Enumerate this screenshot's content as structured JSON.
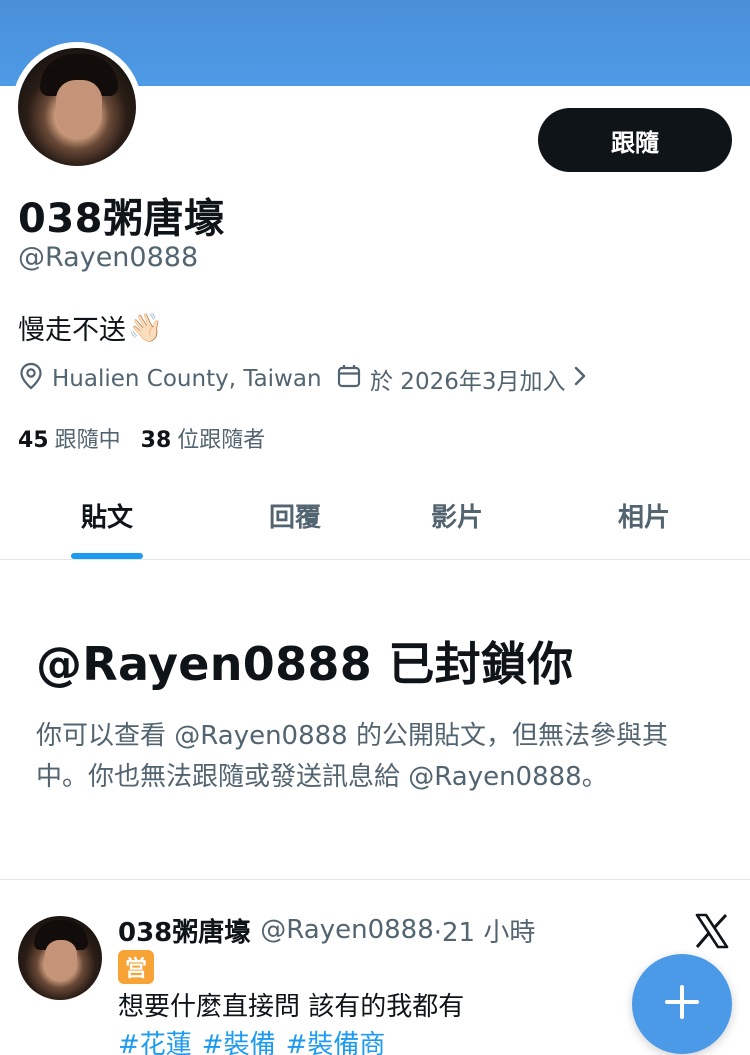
{
  "profile": {
    "display_name": "038粥唐壕",
    "handle": "@Rayen0888",
    "bio": "慢走不送",
    "bio_emoji": "👋🏻",
    "location": "Hualien County, Taiwan",
    "joined": "於 2026年3月加入",
    "following_count": "45",
    "following_label": "跟隨中",
    "followers_count": "38",
    "followers_label": "位跟隨者",
    "follow_button": "跟隨"
  },
  "tabs": [
    {
      "label": "貼文",
      "active": true
    },
    {
      "label": "回覆",
      "active": false
    },
    {
      "label": "影片",
      "active": false
    },
    {
      "label": "相片",
      "active": false
    }
  ],
  "blocked": {
    "title": "@Rayen0888 已封鎖你",
    "description": "你可以查看 @Rayen0888 的公開貼文，但無法參與其中。你也無法跟隨或發送訊息給 @Rayen0888。"
  },
  "post": {
    "name": "038粥唐壕",
    "handle": "@Rayen0888",
    "time": "·21 小時",
    "badge": "営",
    "text": "想要什麼直接問 該有的我都有",
    "tags": [
      "#花蓮",
      "#裝備",
      "#裝備商"
    ]
  },
  "colors": {
    "banner": "#4a92dc",
    "accent": "#1d9bf0",
    "fab": "#4a9ae8",
    "button_dark": "#0f1419"
  },
  "icons": [
    "location-pin-icon",
    "calendar-icon",
    "chevron-right-icon",
    "x-logo-icon",
    "plus-icon"
  ]
}
